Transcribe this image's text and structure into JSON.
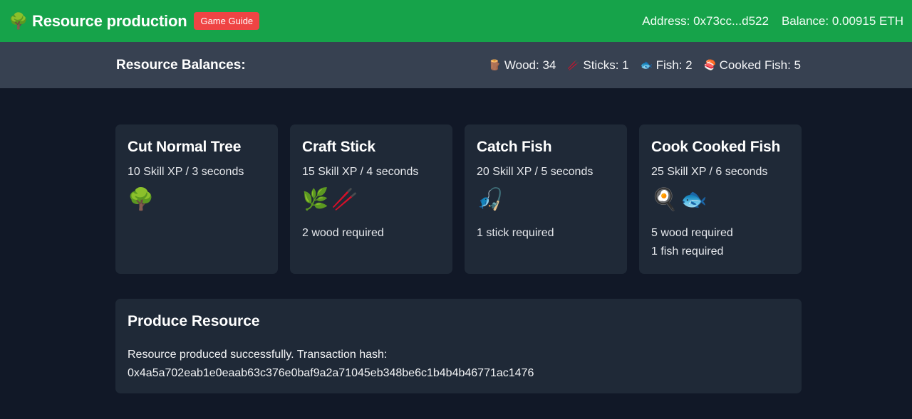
{
  "header": {
    "logo_icon": "🌳",
    "title": "Resource production",
    "guide_label": "Game Guide",
    "address": "Address: 0x73cc...d522",
    "balance": "Balance: 0.00915 ETH",
    "colors": {
      "header_bg": "#16a34a",
      "guide_bg": "#ef4444"
    }
  },
  "balances": {
    "title": "Resource Balances:",
    "items": [
      {
        "icon": "🪵",
        "icon_name": "wood-icon",
        "text": "Wood: 34"
      },
      {
        "icon": "🥢",
        "icon_name": "sticks-icon",
        "text": "Sticks: 1"
      },
      {
        "icon": "🐟",
        "icon_name": "fish-icon",
        "text": "Fish: 2"
      },
      {
        "icon": "🍣",
        "icon_name": "cooked-fish-icon",
        "text": "Cooked Fish: 5"
      }
    ]
  },
  "cards": [
    {
      "title": "Cut Normal Tree",
      "xp": "10 Skill XP / 3 seconds",
      "icons": [
        "🌳"
      ],
      "requirements": []
    },
    {
      "title": "Craft Stick",
      "xp": "15 Skill XP / 4 seconds",
      "icons": [
        "🌿",
        "🥢"
      ],
      "requirements": [
        "2 wood required"
      ]
    },
    {
      "title": "Catch Fish",
      "xp": "20 Skill XP / 5 seconds",
      "icons": [
        "🎣"
      ],
      "requirements": [
        "1 stick required"
      ]
    },
    {
      "title": "Cook Cooked Fish",
      "xp": "25 Skill XP / 6 seconds",
      "icons": [
        "🍳",
        "🐟"
      ],
      "requirements": [
        "5 wood required",
        "1 fish required"
      ]
    }
  ],
  "produce": {
    "title": "Produce Resource",
    "message_line1": "Resource produced successfully. Transaction hash:",
    "message_line2": "0x4a5a702eab1e0eaab63c376e0baf9a2a71045eb348be6c1b4b4b46771ac1476"
  }
}
